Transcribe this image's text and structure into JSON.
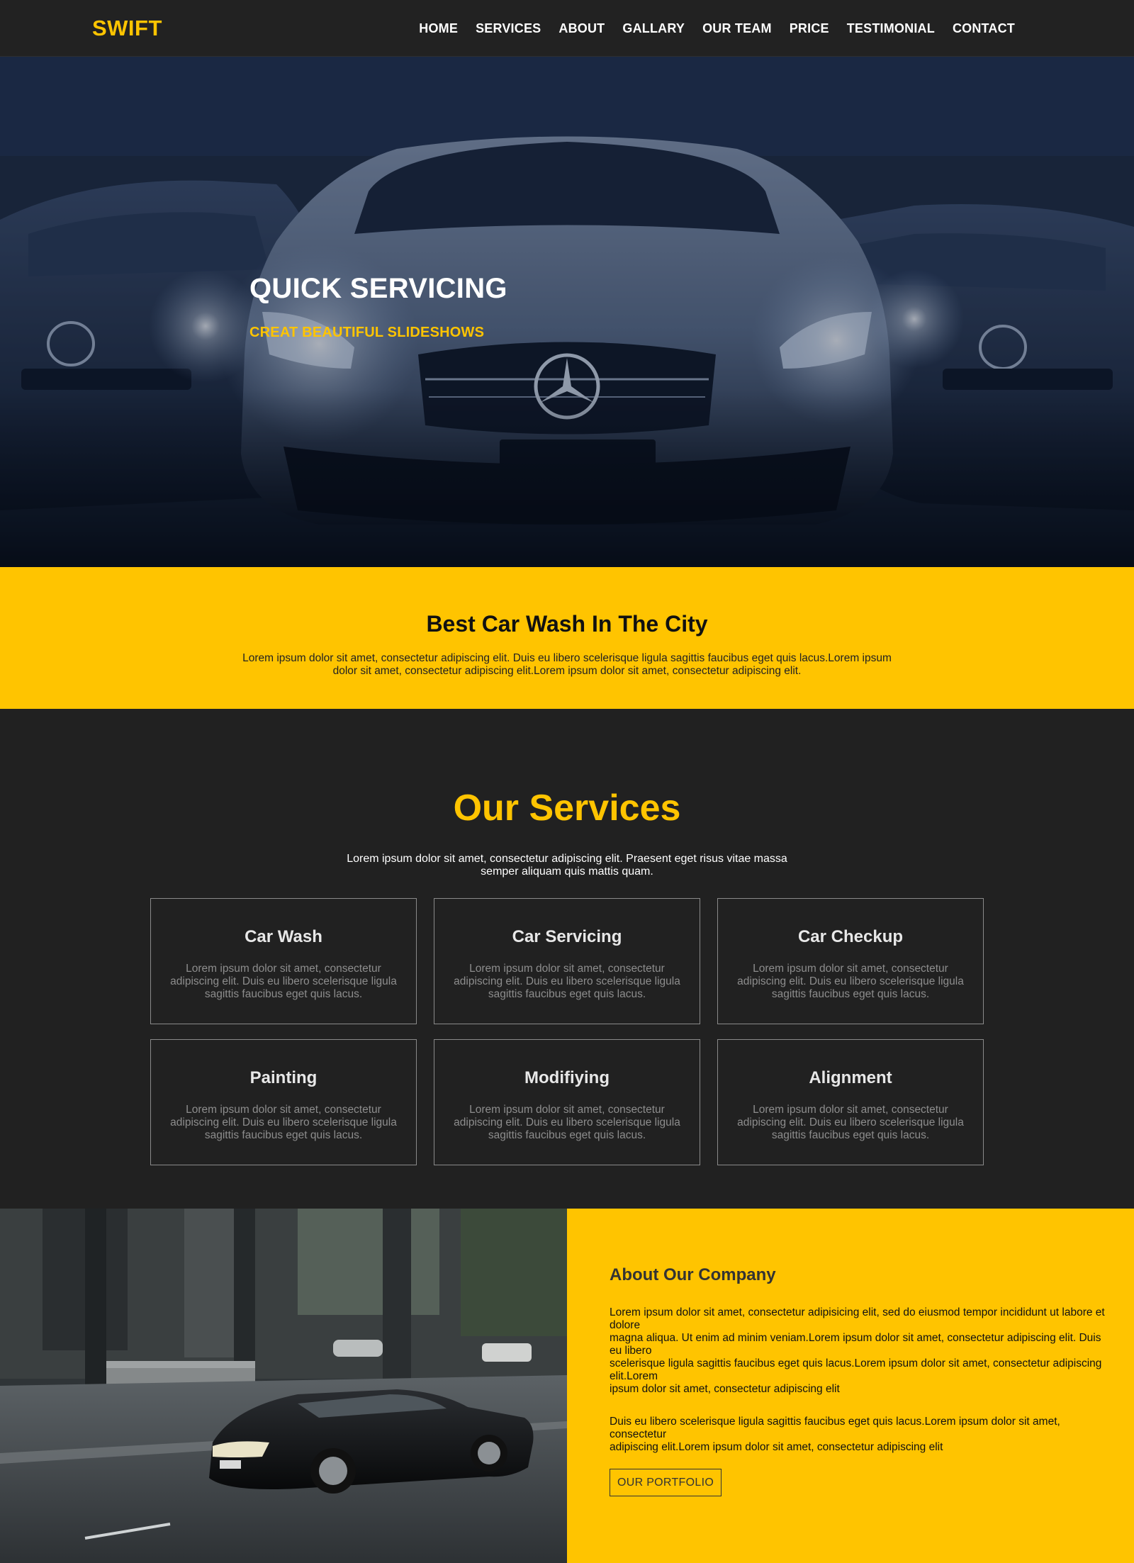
{
  "nav": {
    "logo": "SWIFT",
    "items": [
      "HOME",
      "SERVICES",
      "ABOUT",
      "GALLARY",
      "OUR TEAM",
      "PRICE",
      "TESTIMONIAL",
      "CONTACT"
    ]
  },
  "hero": {
    "title": "QUICK SERVICING",
    "subtitle": "CREAT BEAUTIFUL SLIDESHOWS"
  },
  "band": {
    "title": "Best Car Wash In The City",
    "text": "Lorem ipsum dolor sit amet, consectetur adipiscing elit. Duis eu libero scelerisque ligula sagittis faucibus eget quis lacus.Lorem ipsum dolor sit amet, consectetur adipiscing elit.Lorem ipsum dolor sit amet, consectetur adipiscing elit."
  },
  "services": {
    "title": "Our Services",
    "intro": "Lorem ipsum dolor sit amet, consectetur adipiscing elit. Praesent eget risus vitae massa semper aliquam quis mattis quam.",
    "cards": [
      {
        "title": "Car Wash",
        "text": "Lorem ipsum dolor sit amet, consectetur adipiscing elit. Duis eu libero scelerisque ligula sagittis faucibus eget quis lacus."
      },
      {
        "title": "Car Servicing",
        "text": "Lorem ipsum dolor sit amet, consectetur adipiscing elit. Duis eu libero scelerisque ligula sagittis faucibus eget quis lacus."
      },
      {
        "title": "Car Checkup",
        "text": "Lorem ipsum dolor sit amet, consectetur adipiscing elit. Duis eu libero scelerisque ligula sagittis faucibus eget quis lacus."
      },
      {
        "title": "Painting",
        "text": "Lorem ipsum dolor sit amet, consectetur adipiscing elit. Duis eu libero scelerisque ligula sagittis faucibus eget quis lacus."
      },
      {
        "title": "Modifiying",
        "text": "Lorem ipsum dolor sit amet, consectetur adipiscing elit. Duis eu libero scelerisque ligula sagittis faucibus eget quis lacus."
      },
      {
        "title": "Alignment",
        "text": "Lorem ipsum dolor sit amet, consectetur adipiscing elit. Duis eu libero scelerisque ligula sagittis faucibus eget quis lacus."
      }
    ]
  },
  "about": {
    "title": "About Our Company",
    "p1_lines": [
      "Lorem ipsum dolor sit amet, consectetur adipisicing elit, sed do eiusmod tempor incididunt ut labore et dolore",
      "magna aliqua. Ut enim ad minim veniam.Lorem ipsum dolor sit amet, consectetur adipiscing elit. Duis eu libero",
      "scelerisque ligula sagittis faucibus eget quis lacus.Lorem ipsum dolor sit amet, consectetur adipiscing elit.Lorem",
      "ipsum dolor sit amet, consectetur adipiscing elit"
    ],
    "p2_lines": [
      "Duis eu libero scelerisque ligula sagittis faucibus eget quis lacus.Lorem ipsum dolor sit amet, consectetur",
      "adipiscing elit.Lorem ipsum dolor sit amet, consectetur adipiscing elit"
    ],
    "button": "OUR PORTFOLIO"
  },
  "colors": {
    "accent": "#ffc400",
    "dark_bg": "#212121",
    "nav_bg": "#222222"
  }
}
